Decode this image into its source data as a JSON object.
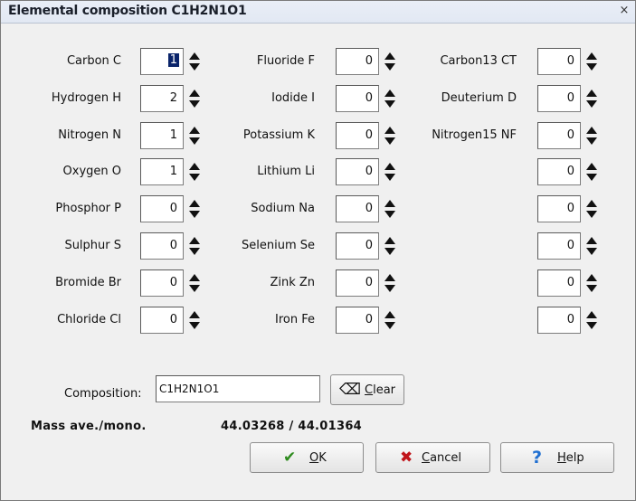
{
  "window": {
    "title": "Elemental composition C1H2N1O1",
    "close_glyph": "×"
  },
  "col1": [
    {
      "label": "Carbon C",
      "value": "1",
      "selected": true
    },
    {
      "label": "Hydrogen H",
      "value": "2"
    },
    {
      "label": "Nitrogen N",
      "value": "1"
    },
    {
      "label": "Oxygen O",
      "value": "1"
    },
    {
      "label": "Phosphor P",
      "value": "0"
    },
    {
      "label": "Sulphur S",
      "value": "0"
    },
    {
      "label": "Bromide Br",
      "value": "0"
    },
    {
      "label": "Chloride Cl",
      "value": "0"
    }
  ],
  "col2": [
    {
      "label": "Fluoride F",
      "value": "0"
    },
    {
      "label": "Iodide I",
      "value": "0"
    },
    {
      "label": "Potassium K",
      "value": "0"
    },
    {
      "label": "Lithium Li",
      "value": "0"
    },
    {
      "label": "Sodium Na",
      "value": "0"
    },
    {
      "label": "Selenium Se",
      "value": "0"
    },
    {
      "label": "Zink Zn",
      "value": "0"
    },
    {
      "label": "Iron Fe",
      "value": "0"
    }
  ],
  "col3": [
    {
      "label": "Carbon13 CT",
      "value": "0"
    },
    {
      "label": "Deuterium D",
      "value": "0"
    },
    {
      "label": "Nitrogen15 NF",
      "value": "0"
    },
    {
      "label": "",
      "value": "0"
    },
    {
      "label": "",
      "value": "0"
    },
    {
      "label": "",
      "value": "0"
    },
    {
      "label": "",
      "value": "0"
    },
    {
      "label": "",
      "value": "0"
    }
  ],
  "composition": {
    "label": "Composition:",
    "value": "C1H2N1O1"
  },
  "clear_button": {
    "mnemonic": "C",
    "rest": "lear",
    "icon": "eraser-icon"
  },
  "mass": {
    "label": "Mass ave./mono.",
    "value": "44.03268 /  44.01364"
  },
  "buttons": {
    "ok": {
      "mnemonic": "O",
      "rest": "K",
      "icon": "check-icon",
      "icon_color": "#2e8b1e"
    },
    "cancel": {
      "mnemonic": "C",
      "rest": "ancel",
      "icon": "x-icon",
      "icon_color": "#c0141a"
    },
    "help": {
      "mnemonic": "H",
      "rest": "elp",
      "icon": "question-icon",
      "icon_color": "#1f6fd1"
    }
  },
  "colors": {
    "selection": "#0a246a",
    "face": "#f0f0f0"
  }
}
